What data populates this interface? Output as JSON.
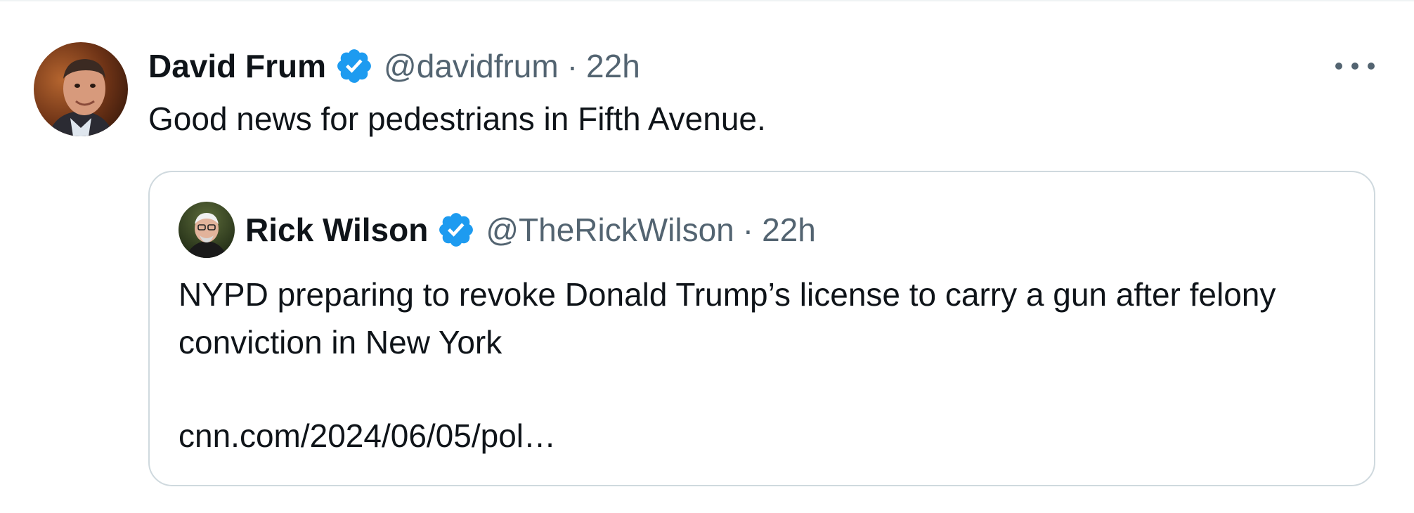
{
  "tweet": {
    "author_name": "David Frum",
    "author_handle": "@davidfrum",
    "separator": "·",
    "time": "22h",
    "text": "Good news for pedestrians in Fifth Avenue.",
    "verified_icon": "verified-badge-icon",
    "more_icon": "more-horizontal-icon"
  },
  "quoted_tweet": {
    "author_name": "Rick Wilson",
    "author_handle": "@TheRickWilson",
    "separator": "·",
    "time": "22h",
    "text": "NYPD preparing to revoke Donald Trump’s license to carry a gun after felony conviction in New York",
    "link": "cnn.com/2024/06/05/pol…",
    "verified_icon": "verified-badge-icon"
  },
  "colors": {
    "text_primary": "#0f1419",
    "text_secondary": "#536471",
    "verified_blue": "#1d9bf0",
    "border": "#cfd9de"
  }
}
